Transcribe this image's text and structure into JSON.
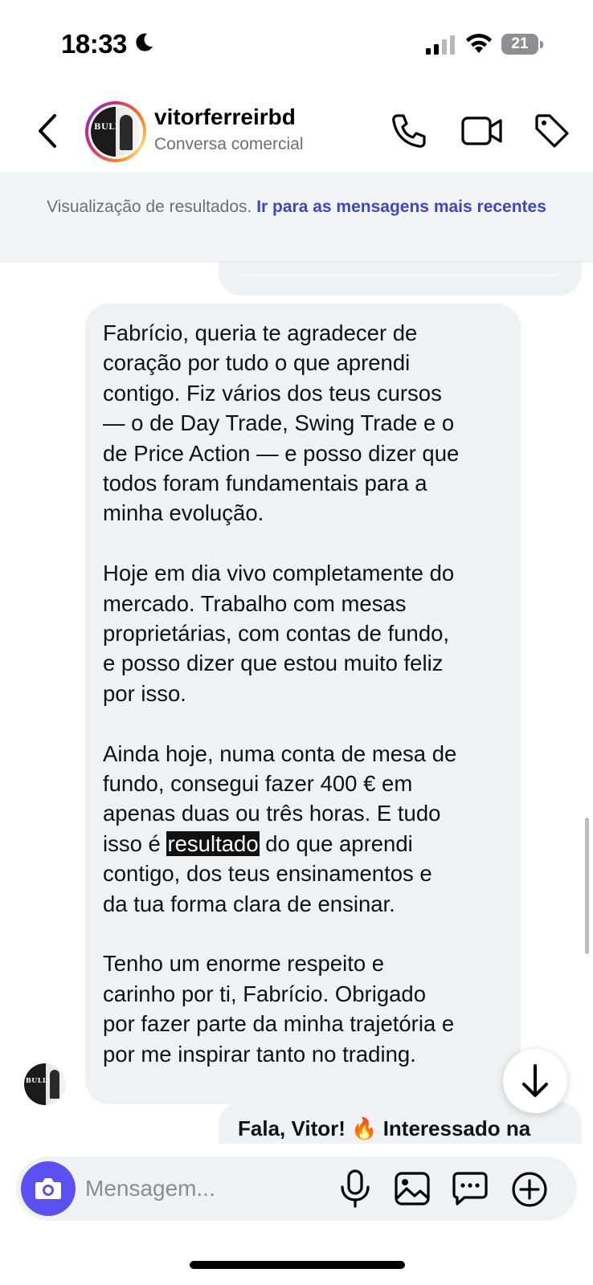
{
  "status_bar": {
    "time": "18:33",
    "battery_level": "21",
    "moon_icon": "moon-icon",
    "signal_icon": "cellular-signal-icon",
    "wifi_icon": "wifi-icon"
  },
  "header": {
    "contact_name": "vitorferreirbd",
    "subtitle": "Conversa comercial",
    "avatar_text": "BULLS",
    "icons": [
      "chevron-left-icon",
      "phone-icon",
      "video-camera-icon",
      "tag-icon"
    ]
  },
  "banner": {
    "prefix": "Visualização de resultados.",
    "link": "Ir para as mensagens mais recentes"
  },
  "message": {
    "paragraphs": [
      "Fabrício, queria te agradecer de\ncoração por tudo o que aprendi\ncontigo. Fiz vários dos teus cursos\n— o de Day Trade, Swing Trade e o\nde Price Action — e posso dizer que\ntodos foram fundamentais para a\nminha evolução.",
      "Hoje em dia vivo completamente do\nmercado. Trabalho com mesas\nproprietárias, com contas de fundo,\ne posso dizer que estou muito feliz\npor isso."
    ],
    "p3_before": "Ainda hoje, numa conta de mesa de\nfundo, consegui fazer 400 € em\napenas duas ou três horas. E tudo\nisso é ",
    "p3_highlight": "resultado",
    "p3_after": " do que aprendi\ncontigo, dos teus ensinamentos e\nda tua forma clara de ensinar.",
    "p4": "Tenho um enorme respeito e\ncarinho por ti, Fabrício. Obrigado\npor fazer parte da minha trajetória e\npor me inspirar tanto no trading."
  },
  "next_message_preview": "Fala, Vitor! 🔥 Interessado na",
  "composer": {
    "placeholder": "Mensagem...",
    "icons": [
      "camera-icon",
      "microphone-icon",
      "gallery-icon",
      "sticker-chat-icon",
      "plus-circle-icon"
    ]
  },
  "colors": {
    "accent_link": "#3b47c9",
    "camera_button": "#5b51f3",
    "bubble": "#eff1f3",
    "banner_bg": "#f2f4f6"
  }
}
